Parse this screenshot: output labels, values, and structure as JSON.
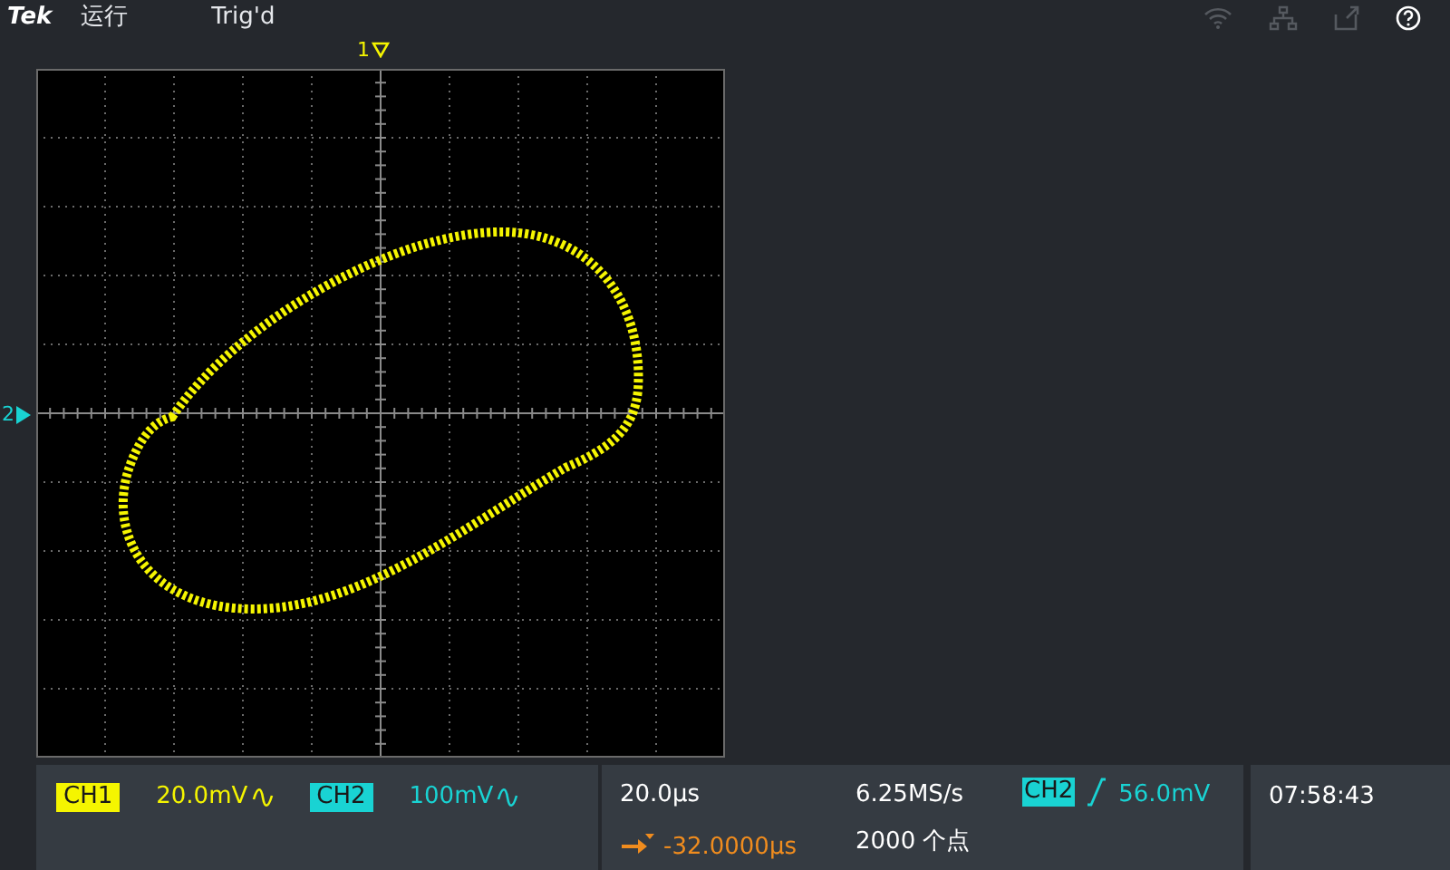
{
  "top_bar": {
    "brand": "Tek",
    "run_state": "运行",
    "trigger_status": "Trig'd"
  },
  "graticule": {
    "ch1_marker": "1",
    "ch2_marker": "2"
  },
  "channels": [
    {
      "label": "CH1",
      "scale": "20.0mV",
      "color": "#f5f500"
    },
    {
      "label": "CH2",
      "scale": "100mV",
      "color": "#19d3d3"
    }
  ],
  "horizontal": {
    "time_per_div": "20.0µs",
    "delay": "-32.0000µs",
    "sample_rate": "6.25MS/s",
    "record_length": "2000 个点"
  },
  "trigger": {
    "source": "CH2",
    "level": "56.0mV"
  },
  "clock": {
    "time": "07:58:43"
  }
}
